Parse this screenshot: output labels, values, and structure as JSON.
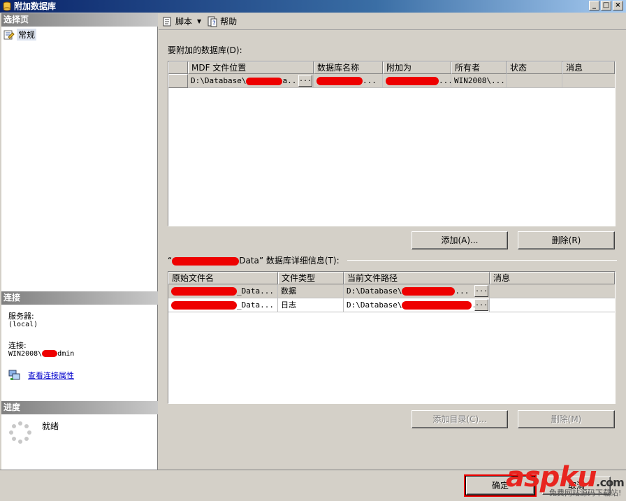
{
  "window": {
    "title": "附加数据库",
    "min_glyph": "_",
    "max_glyph": "□",
    "close_glyph": "×"
  },
  "sidebar": {
    "select_page_header": "选择页",
    "pages": [
      {
        "label": "常规",
        "icon": "page-properties-icon"
      }
    ],
    "connection_header": "连接",
    "server_label": "服务器:",
    "server_value": "(local)",
    "connection_label": "连接:",
    "connection_prefix": "WIN2008\\",
    "connection_suffix": "dmin",
    "view_connection_link": "查看连接属性",
    "progress_header": "进度",
    "progress_status": "就绪"
  },
  "toolbar": {
    "script_label": "脚本",
    "help_label": "帮助"
  },
  "attach": {
    "section_label": "要附加的数据库(D):",
    "columns": [
      "MDF 文件位置",
      "数据库名称",
      "附加为",
      "所有者",
      "状态",
      "消息"
    ],
    "rows": [
      {
        "mdf_location": "D:\\Database\\",
        "mdf_suffix": "a...",
        "db_name": "...",
        "attach_as": "...",
        "owner": "WIN2008\\...",
        "status": "",
        "message": "",
        "ellipsis": "..."
      }
    ],
    "add_button": "添加(A)...",
    "remove_button": "删除(R)"
  },
  "details": {
    "section_label_prefix": "“",
    "section_label_suffix": "Data” 数据库详细信息(T):",
    "columns": [
      "原始文件名",
      "文件类型",
      "当前文件路径",
      "消息"
    ],
    "rows": [
      {
        "file_name": "_Data...",
        "file_type": "数据",
        "path": "D:\\Database\\",
        "path_suffix": "...",
        "message": "",
        "ellipsis": "..."
      },
      {
        "file_name": "_Data...",
        "file_type": "日志",
        "path": "D:\\Database\\",
        "path_suffix": "...",
        "message": "",
        "ellipsis": "..."
      }
    ],
    "add_catalog_button": "添加目录(C)...",
    "remove_button": "删除(M)"
  },
  "footer": {
    "ok_button": "确定",
    "cancel_button_partial": "取消"
  },
  "watermark": {
    "text": "aspku",
    "dot": ".",
    "suffix": "com",
    "subtext": "免费网站源码下载站!"
  },
  "colors": {
    "redaction": "#ee0000",
    "title_start": "#0a246a",
    "title_end": "#a6caf0",
    "link": "#0000cc"
  }
}
